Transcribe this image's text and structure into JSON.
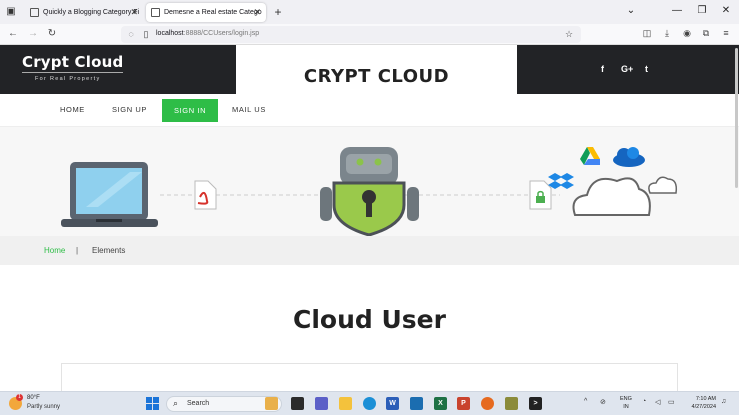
{
  "browser": {
    "tabs": [
      {
        "label": "Quickly a Blogging Category Fi"
      },
      {
        "label": "Demesne a Real estate Catego"
      }
    ],
    "new_tab": "+",
    "url_host": "localhost",
    "url_path": ":8888/CCUsers/login.jsp"
  },
  "site": {
    "brand": "Crypt Cloud",
    "tagline": "For Real Property",
    "title": "CRYPT CLOUD",
    "social": [
      "f",
      "G+",
      "t"
    ]
  },
  "menu": {
    "items": [
      {
        "label": "HOME"
      },
      {
        "label": "SIGN UP"
      },
      {
        "label": "SIGN IN"
      },
      {
        "label": "MAIL US"
      }
    ]
  },
  "breadcrumb": {
    "home": "Home",
    "separator": "|",
    "current": "Elements"
  },
  "main": {
    "heading": "Cloud User"
  },
  "taskbar": {
    "temperature": "80°F",
    "condition": "Partly sunny",
    "badge": "1",
    "search_placeholder": "Search",
    "lang_top": "ENG",
    "lang_bottom": "IN",
    "time": "7:10 AM",
    "date": "4/27/2024"
  },
  "colors": {
    "accent_green": "#2ebd47",
    "header_dark": "#222326"
  },
  "icons": [
    "laptop-icon",
    "pdf-file-icon",
    "robot-lock-icon",
    "locked-file-icon",
    "dropbox-icon",
    "google-drive-icon",
    "onedrive-icon",
    "cloud-icon"
  ]
}
